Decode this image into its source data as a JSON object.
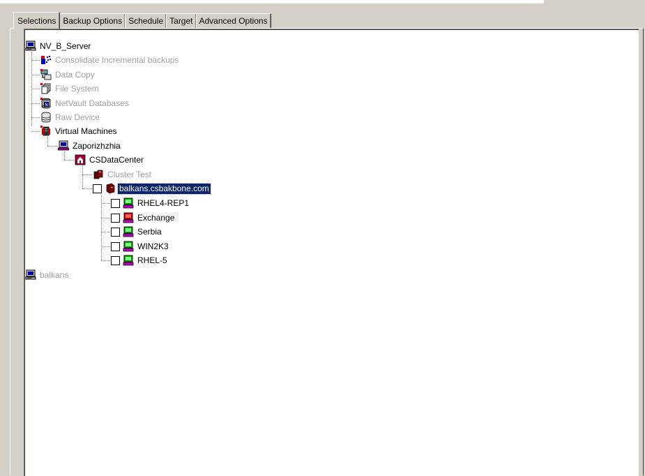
{
  "tabs": [
    {
      "label": "Selections",
      "active": true
    },
    {
      "label": "Backup Options",
      "active": false
    },
    {
      "label": "Schedule",
      "active": false
    },
    {
      "label": "Target",
      "active": false
    },
    {
      "label": "Advanced Options",
      "active": false
    }
  ],
  "tree": {
    "server": {
      "label": "NV_B_Server",
      "icon": "computer-icon"
    },
    "plugins": [
      {
        "label": "Consolidate Incremental backups",
        "icon": "consolidate-icon",
        "enabled": false
      },
      {
        "label": "Data Copy",
        "icon": "data-copy-icon",
        "enabled": false
      },
      {
        "label": "File System",
        "icon": "file-system-icon",
        "enabled": false
      },
      {
        "label": "NetVault Databases",
        "icon": "netvault-database-icon",
        "enabled": false
      },
      {
        "label": "Raw Device",
        "icon": "raw-device-icon",
        "enabled": false
      },
      {
        "label": "Virtual Machines",
        "icon": "virtual-machines-icon",
        "enabled": true
      }
    ],
    "vcenter": {
      "label": "Zaporizhzhia",
      "icon": "vcenter-icon"
    },
    "datacenter": {
      "label": "CSDataCenter",
      "icon": "datacenter-icon"
    },
    "cluster": {
      "label": "Cluster Test",
      "icon": "cluster-icon",
      "enabled": false
    },
    "host": {
      "label": "balkans.csbakbone.com",
      "icon": "esx-host-icon",
      "selected": true,
      "checked": false
    },
    "vms": [
      {
        "label": "RHEL4-REP1",
        "icon": "vm-powered-on-icon",
        "checked": false
      },
      {
        "label": "Exchange",
        "icon": "vm-powered-off-icon",
        "checked": false
      },
      {
        "label": "Serbia",
        "icon": "vm-powered-on-icon",
        "checked": false
      },
      {
        "label": "WIN2K3",
        "icon": "vm-powered-on-icon",
        "checked": false
      },
      {
        "label": "RHEL-5",
        "icon": "vm-powered-on-icon",
        "checked": false
      }
    ],
    "client2": {
      "label": "balkans",
      "icon": "computer-icon",
      "enabled": false
    }
  },
  "colors": {
    "window_bg": "#d4d0c8",
    "tree_bg": "#ffffff",
    "selection_bg": "#0a246a",
    "disabled_text": "#a0a0a0"
  }
}
